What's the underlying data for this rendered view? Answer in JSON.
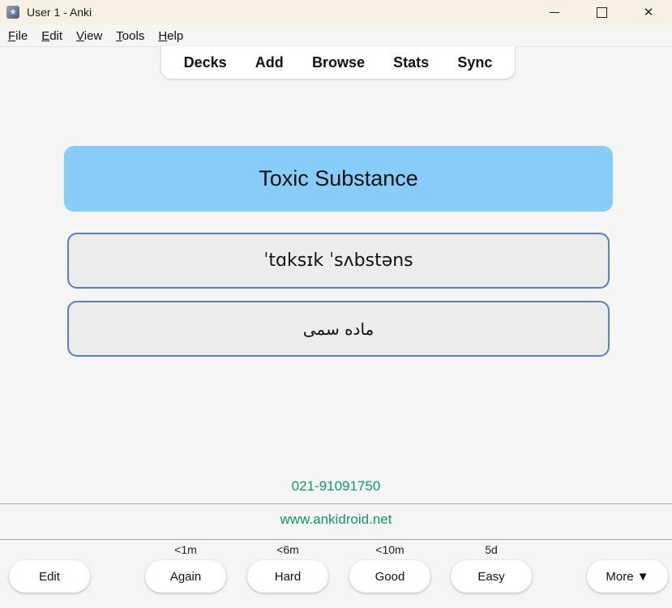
{
  "window": {
    "title": "User 1 - Anki",
    "minimize": "",
    "close": "✕"
  },
  "menu": {
    "file": {
      "u": "F",
      "rest": "ile"
    },
    "edit": {
      "u": "E",
      "rest": "dit"
    },
    "view": {
      "u": "V",
      "rest": "iew"
    },
    "tools": {
      "u": "T",
      "rest": "ools"
    },
    "help": {
      "u": "H",
      "rest": "elp"
    }
  },
  "toolbar": {
    "decks": "Decks",
    "add": "Add",
    "browse": "Browse",
    "stats": "Stats",
    "sync": "Sync"
  },
  "card": {
    "question": "Toxic Substance",
    "phonetic": "ˈtɑksɪk ˈsʌbstəns",
    "translation": "ماده سمی",
    "phone": "021-91091750",
    "website": "www.ankidroid.net"
  },
  "bottom": {
    "edit": "Edit",
    "again": {
      "label": "Again",
      "time": "<1m"
    },
    "hard": {
      "label": "Hard",
      "time": "<6m"
    },
    "good": {
      "label": "Good",
      "time": "<10m"
    },
    "easy": {
      "label": "Easy",
      "time": "5d"
    },
    "more": "More ▼"
  },
  "colors": {
    "question_bg": "#87cdf9",
    "answer_border": "#5b7cc6",
    "link_green": "#0e9a6a"
  }
}
